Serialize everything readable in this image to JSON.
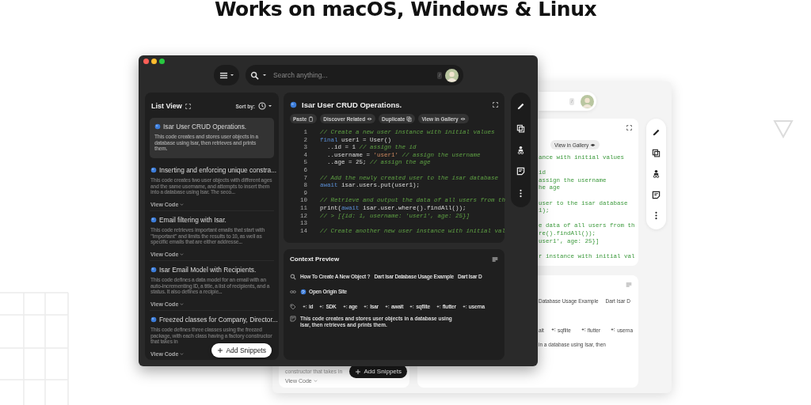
{
  "heading": "Works on macOS, Windows & Linux",
  "dark_window": {
    "toolbar": {
      "search_placeholder": "Search anything...",
      "shortcut": "/"
    },
    "list_panel": {
      "title": "List View",
      "sort_label": "Sort by:",
      "add_button": "Add Snippets",
      "items": [
        {
          "title": "Isar User CRUD Operations.",
          "description": "This code creates and stores user objects in a database using Isar, then retrieves and prints them.",
          "selected": true
        },
        {
          "title": "Inserting and enforcing unique constra...",
          "description": "This code creates two user objects with different ages and the same username, and attempts to insert them into a database using Isar. The seco...",
          "selected": false,
          "view_code": "View Code"
        },
        {
          "title": "Email filtering with Isar.",
          "description": "This code retrieves important emails that start with \"Important\" and limits the results to 10, as well as specific emails that are either addresse...",
          "selected": false,
          "view_code": "View Code"
        },
        {
          "title": "Isar Email Model with Recipients.",
          "description": "This code defines a data model for an email with an auto-incrementing ID, a title, a list of recipients, and a status. It also defines a recipie...",
          "selected": false,
          "view_code": "View Code"
        },
        {
          "title": "Freezed classes for Company, Director...",
          "description": "This code defines three classes using the freezed package, with each class having a factory constructor that takes in",
          "selected": false,
          "view_code": "View Code"
        }
      ]
    },
    "snippet": {
      "title": "Isar User CRUD Operations.",
      "actions": [
        {
          "label": "Paste",
          "kind": "clipboard"
        },
        {
          "label": "Discover Related",
          "kind": "eye"
        },
        {
          "label": "Duplicate",
          "kind": "copy"
        },
        {
          "label": "View in Gallery",
          "kind": "eye"
        }
      ],
      "code": [
        {
          "number": "1",
          "tokens": [
            {
              "kind": "comment",
              "text": "// Create a new user instance with initial values"
            }
          ]
        },
        {
          "number": "2",
          "tokens": [
            {
              "kind": "keyword",
              "text": "final"
            },
            {
              "kind": "plain",
              "text": " user1 = User()"
            }
          ]
        },
        {
          "number": "3",
          "tokens": [
            {
              "kind": "plain",
              "text": "  ..id = 1 "
            },
            {
              "kind": "comment",
              "text": "// assign the id"
            }
          ]
        },
        {
          "number": "4",
          "tokens": [
            {
              "kind": "plain",
              "text": "  ..username = "
            },
            {
              "kind": "string",
              "text": "'user1'"
            },
            {
              "kind": "comment",
              "text": " // assign the username"
            }
          ]
        },
        {
          "number": "5",
          "tokens": [
            {
              "kind": "plain",
              "text": "  ..age = 25; "
            },
            {
              "kind": "comment",
              "text": "// assign the age"
            }
          ]
        },
        {
          "number": "6"
        },
        {
          "number": "7",
          "tokens": [
            {
              "kind": "comment",
              "text": "// Add the newly created user to the isar database"
            }
          ]
        },
        {
          "number": "8",
          "tokens": [
            {
              "kind": "keyword",
              "text": "await"
            },
            {
              "kind": "plain",
              "text": " isar.users.put(user1);"
            }
          ]
        },
        {
          "number": "9"
        },
        {
          "number": "10",
          "tokens": [
            {
              "kind": "comment",
              "text": "// Retrieve and output the data of all users from th"
            }
          ]
        },
        {
          "number": "11",
          "tokens": [
            {
              "kind": "plain",
              "text": "print("
            },
            {
              "kind": "keyword",
              "text": "await"
            },
            {
              "kind": "plain",
              "text": " isar.user.where().findAll());"
            }
          ]
        },
        {
          "number": "12",
          "tokens": [
            {
              "kind": "comment",
              "text": "// > [{id: 1, username: 'user1', age: 25}]"
            }
          ]
        },
        {
          "number": "13"
        },
        {
          "number": "14",
          "tokens": [
            {
              "kind": "comment",
              "text": "// Create another new user instance with initial val"
            }
          ]
        }
      ]
    },
    "context_preview": {
      "title": "Context Preview",
      "queries": [
        "How To Create A New Object ?",
        "Dart Isar Database Usage Example",
        "Dart Isar D"
      ],
      "link": "Open Origin Site",
      "tags": [
        "id",
        "SDK",
        "age",
        "Isar",
        "await",
        "sqflite",
        "flutter",
        "userna"
      ],
      "note": "This code creates and stores user objects in a database using Isar, then retrieves and prints them."
    }
  },
  "light_window": {
    "toolbar": {
      "shortcut": "/"
    },
    "list_fragment": {
      "description": "constructor that takes in",
      "view_code": "View Code",
      "add_button": "Add Snippets"
    },
    "snippet": {
      "action": "View in Gallery",
      "code": [
        {
          "kind": "code",
          "text": "ance with initial values"
        },
        {
          "kind": "blank"
        },
        {
          "kind": "code",
          "text": "id"
        },
        {
          "kind": "code",
          "text": "assign the username"
        },
        {
          "kind": "code",
          "text": "he age"
        },
        {
          "kind": "blank"
        },
        {
          "kind": "code",
          "text": "user to the isar database"
        },
        {
          "kind": "code",
          "text": "1);"
        },
        {
          "kind": "blank"
        },
        {
          "kind": "code",
          "text": "e data of all users from th"
        },
        {
          "kind": "code",
          "text": "re().findAll());"
        },
        {
          "kind": "code",
          "text": "user1', age: 25}]"
        },
        {
          "kind": "blank"
        },
        {
          "kind": "code",
          "text": "r instance with initial val"
        }
      ]
    },
    "context_preview": {
      "queries": [
        "Database Usage Example",
        "Dart Isar D"
      ],
      "tag_fragment": "ait",
      "tags": [
        "sqflite",
        "flutter",
        "userna"
      ],
      "note": "in a database using Isar, then"
    }
  }
}
